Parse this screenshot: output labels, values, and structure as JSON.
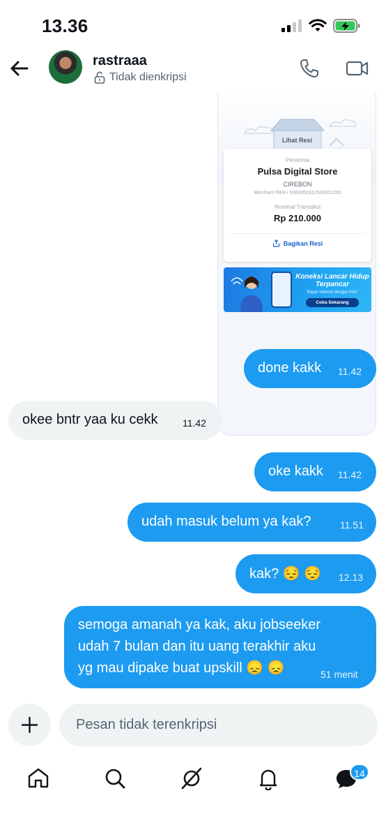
{
  "status_bar": {
    "time": "13.36",
    "icons": [
      "cellular-signal-icon",
      "wifi-icon",
      "battery-charging-icon"
    ]
  },
  "header": {
    "contact_name": "rastraaa",
    "encryption_status": "Tidak dienkripsi",
    "icons": [
      "back-arrow-icon",
      "lock-open-icon",
      "phone-icon",
      "video-icon"
    ]
  },
  "receipt": {
    "lihat_resi": "Lihat Resi",
    "penerima_label": "Penerima",
    "store_name": "Pulsa Digital Store",
    "city": "CIREBON",
    "merchant_pan": "Merchant PAN • 9360050312500001265",
    "nominal_label": "Nominal Transaksi",
    "amount": "Rp 210.000",
    "share_label": "Bagikan Resi",
    "promo": {
      "title": "Koneksi Lancar Hidup Terpancar",
      "subtitle": "Bayar Internet dengan livin'",
      "cta": "Coba Sekarang"
    }
  },
  "messages": [
    {
      "direction": "out",
      "text": "done kakk",
      "time": "11.42"
    },
    {
      "direction": "in",
      "text": "okee bntr yaa ku cekk",
      "time": "11.42"
    },
    {
      "direction": "out",
      "text": "oke kakk",
      "time": "11.42"
    },
    {
      "direction": "out",
      "text": "udah masuk belum ya kak?",
      "time": "11.51"
    },
    {
      "direction": "out",
      "text": "kak? 😔 😔",
      "time": "12.13"
    },
    {
      "direction": "out",
      "text": "semoga amanah ya kak, aku jobseeker\nudah 7 bulan dan itu uang terakhir aku\nyg mau dipake buat upskill 😞 😞",
      "time": "51 menit"
    }
  ],
  "composer": {
    "placeholder": "Pesan tidak terenkripsi"
  },
  "bottom_nav": {
    "items": [
      "home-icon",
      "search-icon",
      "grok-icon",
      "notifications-bell-icon",
      "messages-icon"
    ],
    "messages_badge": "14"
  },
  "colors": {
    "accent": "#1d9bf0",
    "incoming_bubble": "#eff3f4",
    "text_primary": "#0f1419",
    "text_secondary": "#536471"
  }
}
